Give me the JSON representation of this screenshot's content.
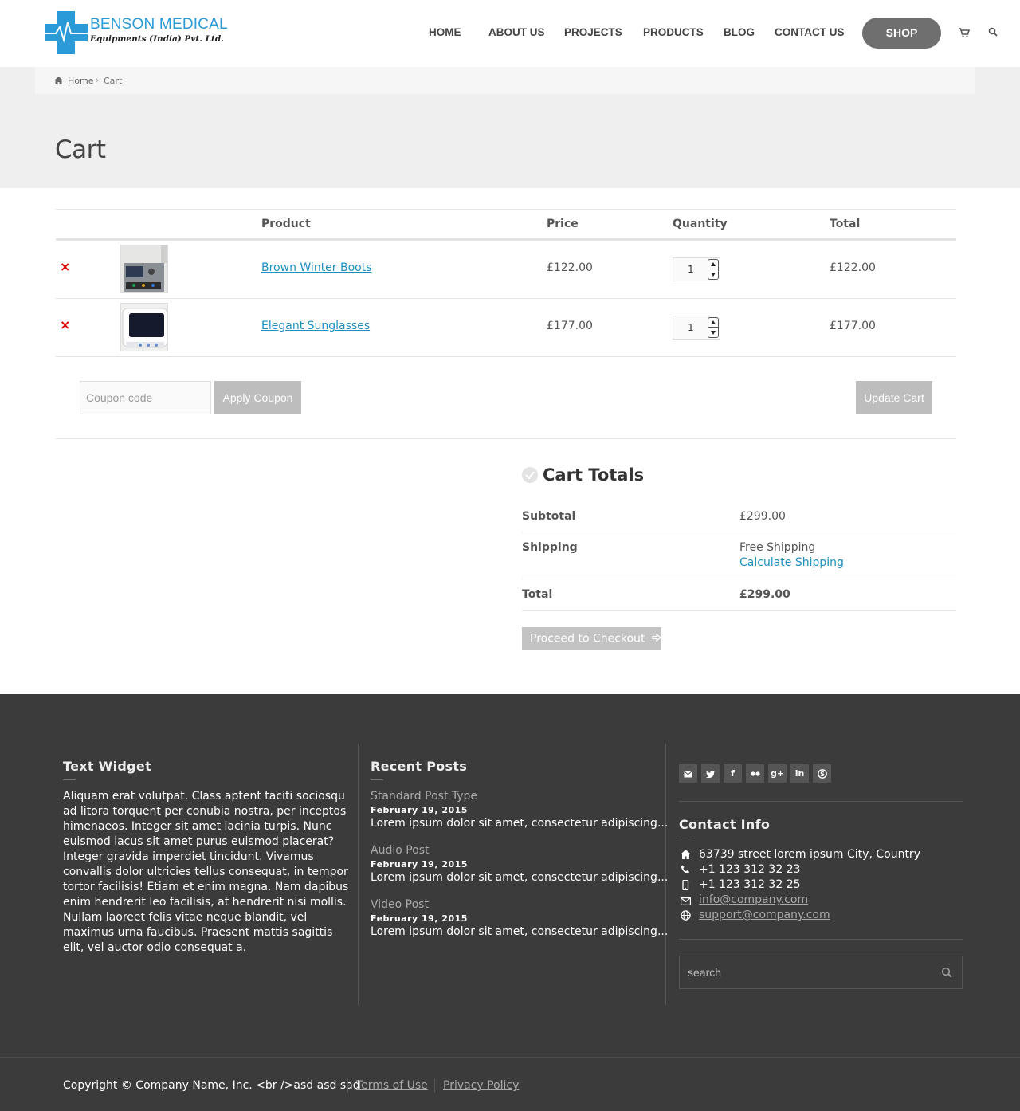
{
  "brand": {
    "name": "BENSON MEDICAL",
    "tagline": "Equipments (India) Pvt. Ltd.",
    "color": "#2a9bd6"
  },
  "nav": {
    "items": [
      "HOME",
      "ABOUT US",
      "PROJECTS",
      "PRODUCTS",
      "BLOG",
      "CONTACT US"
    ],
    "shop_label": "SHOP",
    "cart_icon": "cart-icon",
    "search_icon": "search-icon"
  },
  "breadcrumb": {
    "home": "Home",
    "separator": "›",
    "current": "Cart"
  },
  "page": {
    "title": "Cart"
  },
  "cart": {
    "headers": {
      "product": "Product",
      "price": "Price",
      "quantity": "Quantity",
      "total": "Total"
    },
    "remove_symbol": "×",
    "rows": [
      {
        "product": "Brown Winter Boots",
        "price": "£122.00",
        "quantity": "1",
        "total": "£122.00"
      },
      {
        "product": "Elegant Sunglasses",
        "price": "£177.00",
        "quantity": "1",
        "total": "£177.00"
      }
    ],
    "coupon_placeholder": "Coupon code",
    "apply_coupon_label": "Apply Coupon",
    "update_cart_label": "Update Cart"
  },
  "totals": {
    "title": "Cart Totals",
    "subtotal_label": "Subtotal",
    "subtotal_value": "£299.00",
    "shipping_label": "Shipping",
    "shipping_value": "Free Shipping",
    "calculate_shipping": "Calculate Shipping",
    "total_label": "Total",
    "total_value": "£299.00",
    "checkout_label": "Proceed to Checkout"
  },
  "footer": {
    "text_widget": {
      "title": "Text Widget",
      "body": "Aliquam erat volutpat. Class aptent taciti sociosqu ad litora torquent per conubia nostra, per inceptos himenaeos. Integer sit amet lacinia turpis. Nunc euismod lacus sit amet purus euismod placerat? Integer gravida imperdiet tincidunt. Vivamus convallis dolor ultricies tellus consequat, in tempor tortor facilisis! Etiam et enim magna. Nam dapibus enim hendrerit leo facilisis, at hendrerit nisi mollis. Nullam laoreet felis vitae neque blandit, vel maximus urna faucibus. Praesent mattis sagittis elit, vel auctor odio consequat a."
    },
    "recent_posts": {
      "title": "Recent Posts",
      "posts": [
        {
          "title": "Standard Post Type",
          "date": "February 19, 2015",
          "excerpt": "Lorem ipsum dolor sit amet, consectetur adipiscing..."
        },
        {
          "title": "Audio Post",
          "date": "February 19, 2015",
          "excerpt": "Lorem ipsum dolor sit amet, consectetur adipiscing..."
        },
        {
          "title": "Video Post",
          "date": "February 19, 2015",
          "excerpt": "Lorem ipsum dolor sit amet, consectetur adipiscing..."
        }
      ]
    },
    "social": [
      "mail-icon",
      "twitter-icon",
      "facebook-icon",
      "flickr-icon",
      "google-plus-icon",
      "linkedin-icon",
      "skype-icon"
    ],
    "contact": {
      "title": "Contact Info",
      "address": "63739 street lorem ipsum City, Country",
      "phone": "+1 123 312 32 23",
      "mobile": "+1 123 312 32 25",
      "email": "info@company.com",
      "support": "support@company.com"
    },
    "search_placeholder": "search",
    "copyright": "Copyright © Company Name, Inc. <br />asd asd sad",
    "terms": "Terms of Use",
    "privacy": "Privacy Policy"
  }
}
